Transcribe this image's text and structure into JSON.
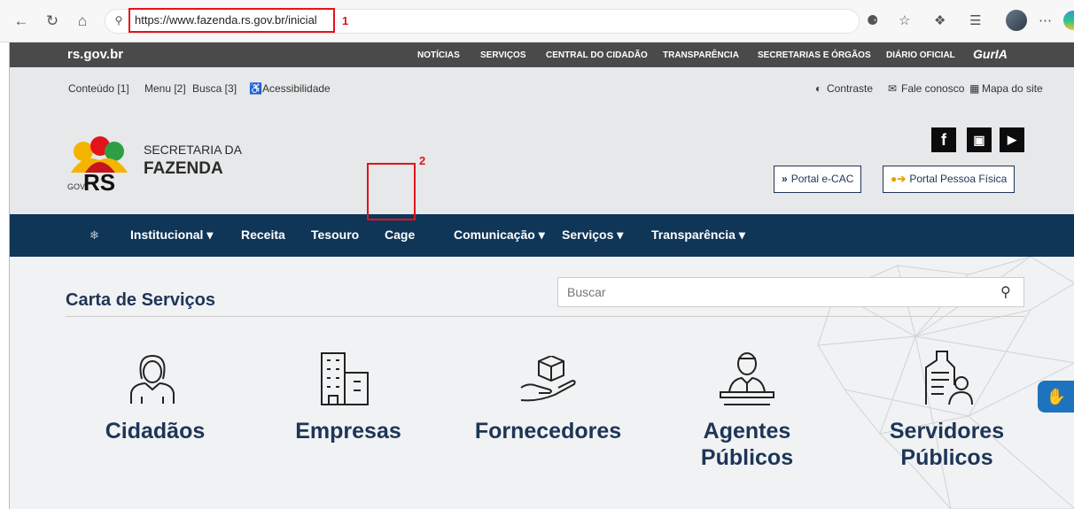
{
  "browser": {
    "url": "https://www.fazenda.rs.gov.br/inicial",
    "callout_1": "1",
    "callout_2": "2",
    "back_icon": "arrow-left-icon",
    "more_icon": "ellipsis-icon"
  },
  "topbar": {
    "logo": "rs.gov.br",
    "links": [
      "NOTÍCIAS",
      "SERVIÇOS",
      "CENTRAL DO CIDADÃO",
      "TRANSPARÊNCIA",
      "SECRETARIAS E ÓRGÃOS",
      "DIÁRIO OFICIAL"
    ],
    "assistant": "GurIA"
  },
  "accessibility": {
    "left": [
      "Conteúdo [1]",
      "Menu [2]",
      "Busca [3]",
      "Acessibilidade"
    ],
    "right": [
      "Contraste",
      "Fale conosco",
      "Mapa do site"
    ]
  },
  "header": {
    "org_small": "SECRETARIA DA",
    "org_big": "FAZENDA",
    "logo_gov": "GOV",
    "logo_rs": "RS",
    "portal_ecac": "Portal e-CAC",
    "portal_pf": "Portal Pessoa Física"
  },
  "nav": {
    "items": [
      "Institucional ▾",
      "Receita",
      "Tesouro",
      "Cage",
      "Comunicação ▾",
      "Serviços ▾",
      "Transparência ▾"
    ]
  },
  "content": {
    "title": "Carta de Serviços",
    "search_placeholder": "Buscar",
    "services": [
      "Cidadãos",
      "Empresas",
      "Fornecedores",
      "Agentes Públicos",
      "Servidores Públicos"
    ]
  },
  "colors": {
    "navy": "#0f3557",
    "title_blue": "#1d3557",
    "highlight_red": "#e3131c"
  }
}
